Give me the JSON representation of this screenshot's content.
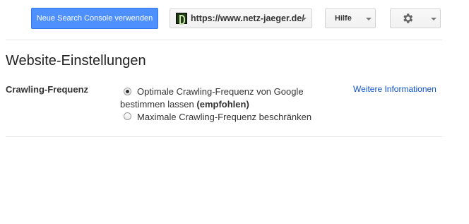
{
  "toolbar": {
    "new_console_label": "Neue Search Console verwenden",
    "site_url": "https://www.netz-jaeger.de/",
    "help_label": "Hilfe",
    "favicon_icon": "site-favicon-icon",
    "settings_icon": "gear-icon"
  },
  "main": {
    "title": "Website-Einstellungen",
    "crawl": {
      "label": "Crawling-Frequenz",
      "option1_line1": "Optimale Crawling-Frequenz von Google",
      "option1_line2": "bestimmen lassen",
      "option1_recommended": "(empfohlen)",
      "option1_selected": true,
      "option2_label": "Maximale Crawling-Frequenz beschränken",
      "option2_selected": false
    },
    "more_info_link": "Weitere Informationen"
  },
  "colors": {
    "primary_button": "#4d90fe",
    "link": "#1155cc"
  }
}
